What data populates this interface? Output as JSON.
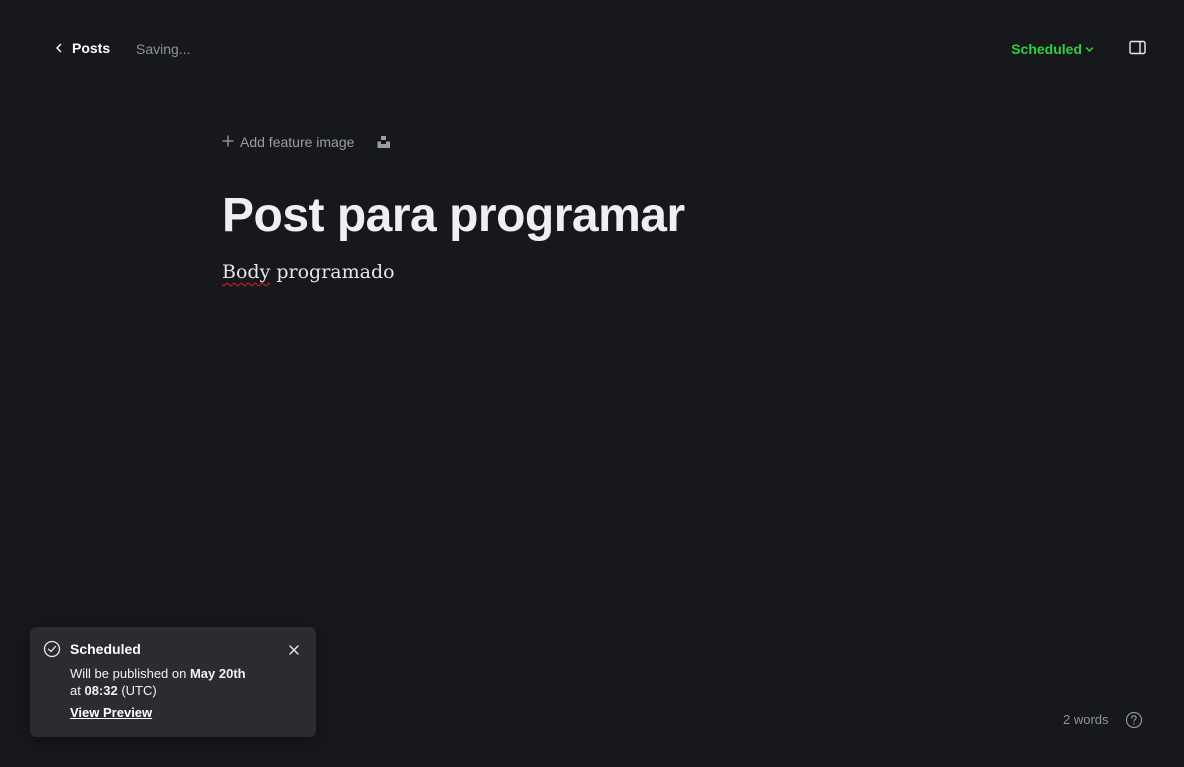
{
  "header": {
    "back_label": "Posts",
    "save_status": "Saving...",
    "status_label": "Scheduled",
    "status_color": "#30cf43"
  },
  "editor": {
    "add_feature_label": "Add feature image",
    "title": "Post para programar",
    "body_word_1": "Body",
    "body_rest": " programado"
  },
  "toast": {
    "title": "Scheduled",
    "message_prefix": "Will be published on ",
    "date": "May 20th",
    "line2_prefix": "at ",
    "time": "08:32",
    "timezone": " (UTC)",
    "preview_label": "View Preview"
  },
  "footer": {
    "word_count": "2 words"
  },
  "icons": {
    "back": "chevron-left-icon",
    "status_caret": "chevron-down-icon",
    "sidebar": "sidebar-toggle-icon",
    "add": "plus-icon",
    "unsplash": "unsplash-icon",
    "check": "check-circle-icon",
    "close": "close-icon",
    "help": "help-icon"
  }
}
